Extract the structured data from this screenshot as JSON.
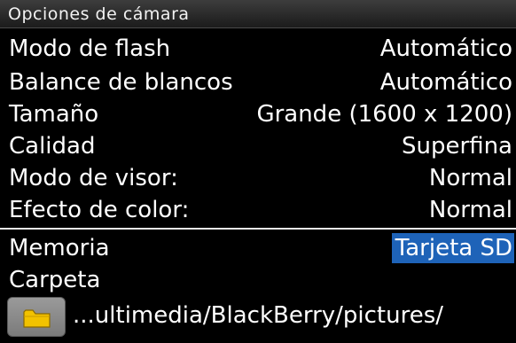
{
  "title": "Opciones de cámara",
  "settings": [
    {
      "label": "Modo de flash",
      "value": "Automático"
    },
    {
      "label": "Balance de blancos",
      "value": "Automático"
    },
    {
      "label": "Tamaño",
      "value": "Grande (1600 x 1200)"
    },
    {
      "label": "Calidad",
      "value": "Superfina"
    },
    {
      "label": "Modo de visor:",
      "value": "Normal"
    },
    {
      "label": "Efecto de color:",
      "value": "Normal"
    }
  ],
  "memory": {
    "label": "Memoria",
    "value": "Tarjeta SD"
  },
  "folder": {
    "label": "Carpeta",
    "path": "...ultimedia/BlackBerry/pictures/",
    "icon": "folder-icon"
  },
  "colors": {
    "background": "#000000",
    "text": "#ffffff",
    "selection": "#1e63b8",
    "folder": "#f2c200"
  }
}
